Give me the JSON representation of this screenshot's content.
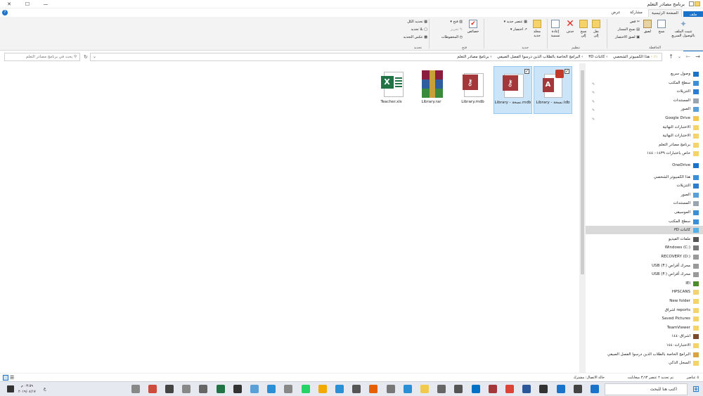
{
  "window": {
    "title": "برنامج مصادر التعلم",
    "minimize_icon": "—",
    "maximize_icon": "☐",
    "close_icon": "✕"
  },
  "tabs": [
    "ملف",
    "الصفحة الرئيسية",
    "مشاركة",
    "عرض"
  ],
  "ribbon": {
    "pin_label": "تثبيت الملف بالوصول السريع",
    "copy_label": "نسخ",
    "paste_label": "لصق",
    "cut_label": "قص",
    "copy_path_label": "نسخ المسار",
    "paste_shortcut_label": "لصق الاختصار",
    "clipboard_group": "الحافظة",
    "move_to_label": "نقل إلى",
    "copy_to_label": "نسخ إلى",
    "delete_label": "حذف",
    "rename_label": "إعادة تسمية",
    "organize_group": "تنظيم",
    "new_folder_label": "مجلد جديد",
    "new_item_label": "عنصر جديد",
    "easy_access_label": "اختصار",
    "new_group": "جديد",
    "properties_label": "خصائص",
    "open_label": "فتح",
    "edit_label": "تحرير",
    "history_label": "المحفوظات",
    "open_group": "فتح",
    "select_all_label": "تحديد الكل",
    "select_none_label": "بلا تحديد",
    "invert_selection_label": "عكس التحديد",
    "select_group": "تحديد"
  },
  "address": {
    "breadcrumbs": [
      "هذا الكمبيوتر الشخصي",
      "كائنات ٣D",
      "البرامج الخاصة بالطلاب الذين درسوا الفصل الصيفي",
      "برنامج مصادر التعلم"
    ],
    "search_placeholder": "بحث في برنامج مصادر التعلم"
  },
  "files": [
    {
      "name": "Library - نسخة.ldb",
      "selected": true,
      "type": "access-lock"
    },
    {
      "name": "Library - نسخة.mdb",
      "selected": true,
      "type": "access"
    },
    {
      "name": "Library.mdb",
      "selected": false,
      "type": "access"
    },
    {
      "name": "Library.rar",
      "selected": false,
      "type": "rar"
    },
    {
      "name": "Teacher.xls",
      "selected": false,
      "type": "excel"
    }
  ],
  "navpane": [
    {
      "label": "وصول سريع",
      "icon": "star-icon",
      "color": "#1a73c9",
      "pinned": false
    },
    {
      "label": "سطح المكتب",
      "icon": "desktop-icon",
      "color": "#3a8fd6",
      "pinned": true
    },
    {
      "label": "التنزيلات",
      "icon": "download-icon",
      "color": "#2b7cd3",
      "pinned": true
    },
    {
      "label": "المستندات",
      "icon": "document-icon",
      "color": "#9aa5b1",
      "pinned": true
    },
    {
      "label": "الصور",
      "icon": "pictures-icon",
      "color": "#5aa0d8",
      "pinned": true
    },
    {
      "label": "Google Drive",
      "icon": "drive-icon",
      "color": "#f2c94c",
      "pinned": true
    },
    {
      "label": "الاختبارات النهائية",
      "icon": "folder-icon",
      "color": "#f5d36b",
      "pinned": false
    },
    {
      "label": "الاختبارات النهائية",
      "icon": "folder-icon",
      "color": "#f5d36b",
      "pinned": false
    },
    {
      "label": "برنامج مصادر التعلم",
      "icon": "folder-icon",
      "color": "#f5d36b",
      "pinned": false
    },
    {
      "label": "خاص باختبارات ١٤٣٩-١٤٤٠",
      "icon": "folder-icon",
      "color": "#f5d36b",
      "pinned": false
    },
    {
      "label": "OneDrive",
      "icon": "cloud-icon",
      "color": "#1a73c9",
      "pinned": false
    },
    {
      "label": "هذا الكمبيوتر الشخصي",
      "icon": "computer-icon",
      "color": "#3a8fd6",
      "pinned": false
    },
    {
      "label": "التنزيلات",
      "icon": "download-icon",
      "color": "#2b7cd3",
      "pinned": false
    },
    {
      "label": "الصور",
      "icon": "pictures-icon",
      "color": "#5aa0d8",
      "pinned": false
    },
    {
      "label": "المستندات",
      "icon": "document-icon",
      "color": "#9aa5b1",
      "pinned": false
    },
    {
      "label": "الموسيقى",
      "icon": "music-icon",
      "color": "#3a8fd6",
      "pinned": false
    },
    {
      "label": "سطح المكتب",
      "icon": "desktop-icon",
      "color": "#3a8fd6",
      "pinned": false
    },
    {
      "label": "كائنات ٣D",
      "icon": "cube-icon",
      "color": "#4fb3e8",
      "pinned": false
    },
    {
      "label": "ملفات الفيديو",
      "icon": "video-icon",
      "color": "#555555",
      "pinned": false
    },
    {
      "label": "Windows (C:)",
      "icon": "drive-c-icon",
      "color": "#777777",
      "pinned": false
    },
    {
      "label": "RECOVERY (D:)",
      "icon": "drive-icon",
      "color": "#999999",
      "pinned": false
    },
    {
      "label": "محرك أقراص USB (F:)",
      "icon": "usb-icon",
      "color": "#999999",
      "pinned": false
    },
    {
      "label": "محرك أقراص USB (F:)",
      "icon": "usb-icon",
      "color": "#999999",
      "pinned": false
    },
    {
      "label": "IEI",
      "icon": "tree-icon",
      "color": "#4c8c2b",
      "pinned": false
    },
    {
      "label": "HPSCANS",
      "icon": "folder-icon",
      "color": "#f5d36b",
      "pinned": false
    },
    {
      "label": "New folder",
      "icon": "folder-icon",
      "color": "#f5d36b",
      "pinned": false
    },
    {
      "label": "reports اشراق",
      "icon": "folder-icon",
      "color": "#f5d36b",
      "pinned": false
    },
    {
      "label": "Saved Pictures",
      "icon": "folder-icon",
      "color": "#f5d36b",
      "pinned": false
    },
    {
      "label": "TeamViewer",
      "icon": "folder-icon",
      "color": "#f5d36b",
      "pinned": false
    },
    {
      "label": "اشراق١٤٤٠",
      "icon": "image-folder-icon",
      "color": "#7a4a2a",
      "pinned": false
    },
    {
      "label": "الاختبارات١٤٤٠",
      "icon": "folder-icon",
      "color": "#f5d36b",
      "pinned": false
    },
    {
      "label": "البرامج الخاصة بالطلاب الذين درسوا الفصل الصيفي",
      "icon": "special-folder-icon",
      "color": "#d9a43a",
      "pinned": false
    },
    {
      "label": "السجل الذكي",
      "icon": "folder-icon",
      "color": "#f5d36b",
      "pinned": false
    }
  ],
  "status": {
    "items": "٥ عناصر",
    "selected": "تم تحديد ٢ عنصر ٣٫٦٣ ميغابايت",
    "availability": "حالة الاتصال: مشترك"
  },
  "taskbar": {
    "search_placeholder": "اكتب هنا للبحث",
    "time": "٠٣:٥٩ م",
    "date": "٢٠١٩/٠٤/١٧",
    "lang": "ع",
    "apps": [
      {
        "name": "start-icon",
        "color": "#1a73c9"
      },
      {
        "name": "task-view-icon",
        "color": "#444444"
      },
      {
        "name": "edge-icon",
        "color": "#1a73c9"
      },
      {
        "name": "store-icon",
        "color": "#333333"
      },
      {
        "name": "word-icon",
        "color": "#2b579a"
      },
      {
        "name": "chrome-icon",
        "color": "#db4437"
      },
      {
        "name": "access-icon",
        "color": "#a4373a"
      },
      {
        "name": "outlook-icon",
        "color": "#0072c6"
      },
      {
        "name": "app-icon",
        "color": "#555555"
      },
      {
        "name": "mail-icon",
        "color": "#666666"
      },
      {
        "name": "explorer-icon",
        "color": "#f2c94c"
      },
      {
        "name": "photos-icon",
        "color": "#2b8fd6"
      },
      {
        "name": "app-icon",
        "color": "#777777"
      },
      {
        "name": "firefox-icon",
        "color": "#e66000"
      },
      {
        "name": "app-icon",
        "color": "#555555"
      },
      {
        "name": "app-icon",
        "color": "#2b8fd6"
      },
      {
        "name": "app-icon",
        "color": "#f2a900"
      },
      {
        "name": "whatsapp-icon",
        "color": "#25d366"
      },
      {
        "name": "app-icon",
        "color": "#888888"
      },
      {
        "name": "globe-icon",
        "color": "#2b8fd6"
      },
      {
        "name": "app-icon",
        "color": "#5aa0d8"
      },
      {
        "name": "app-icon",
        "color": "#333333"
      },
      {
        "name": "excel-icon",
        "color": "#217346"
      },
      {
        "name": "app-icon",
        "color": "#666666"
      },
      {
        "name": "app-icon",
        "color": "#888888"
      },
      {
        "name": "app-icon",
        "color": "#444444"
      },
      {
        "name": "app-icon",
        "color": "#d04a3a"
      },
      {
        "name": "app-icon",
        "color": "#888888"
      }
    ]
  },
  "colors": {
    "accent": "#1a73c9",
    "selection": "#cce4f7"
  }
}
